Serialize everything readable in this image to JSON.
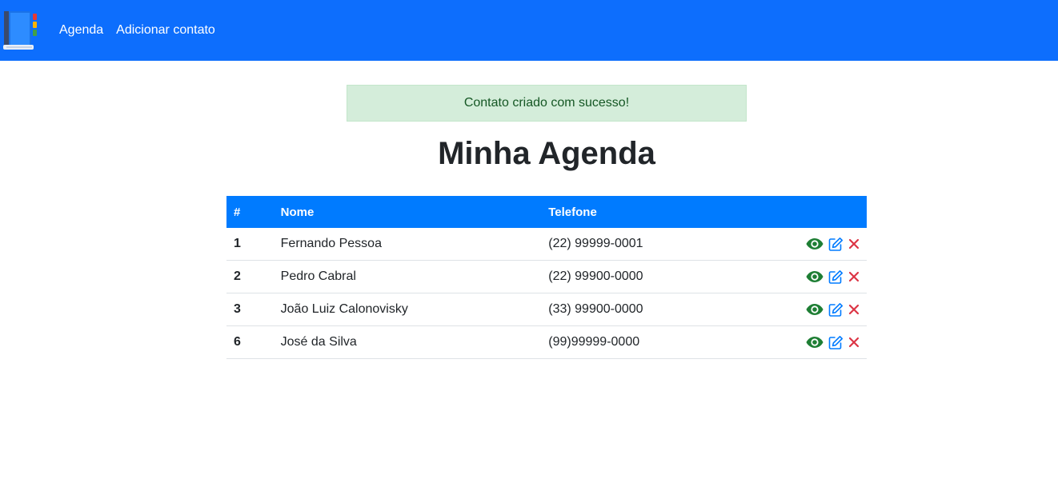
{
  "navbar": {
    "logo_icon": "address-book-icon",
    "links": [
      {
        "label": "Agenda"
      },
      {
        "label": "Adicionar contato"
      }
    ],
    "color": "#0d6efd"
  },
  "alert": {
    "message": "Contato criado com sucesso!"
  },
  "page": {
    "title": "Minha Agenda"
  },
  "table": {
    "headers": [
      "#",
      "Nome",
      "Telefone",
      ""
    ],
    "rows": [
      {
        "id": "1",
        "name": "Fernando Pessoa",
        "phone": "(22) 99999-0001"
      },
      {
        "id": "2",
        "name": "Pedro Cabral",
        "phone": "(22) 99900-0000"
      },
      {
        "id": "3",
        "name": "João Luiz Calonovisky",
        "phone": "(33) 99900-0000"
      },
      {
        "id": "6",
        "name": "José da Silva",
        "phone": "(99)99999-0000"
      }
    ],
    "action_icons": [
      "eye-icon",
      "edit-icon",
      "delete-icon"
    ],
    "action_colors": {
      "view": "#1e7e34",
      "edit": "#007bff",
      "delete": "#dc3545"
    }
  }
}
